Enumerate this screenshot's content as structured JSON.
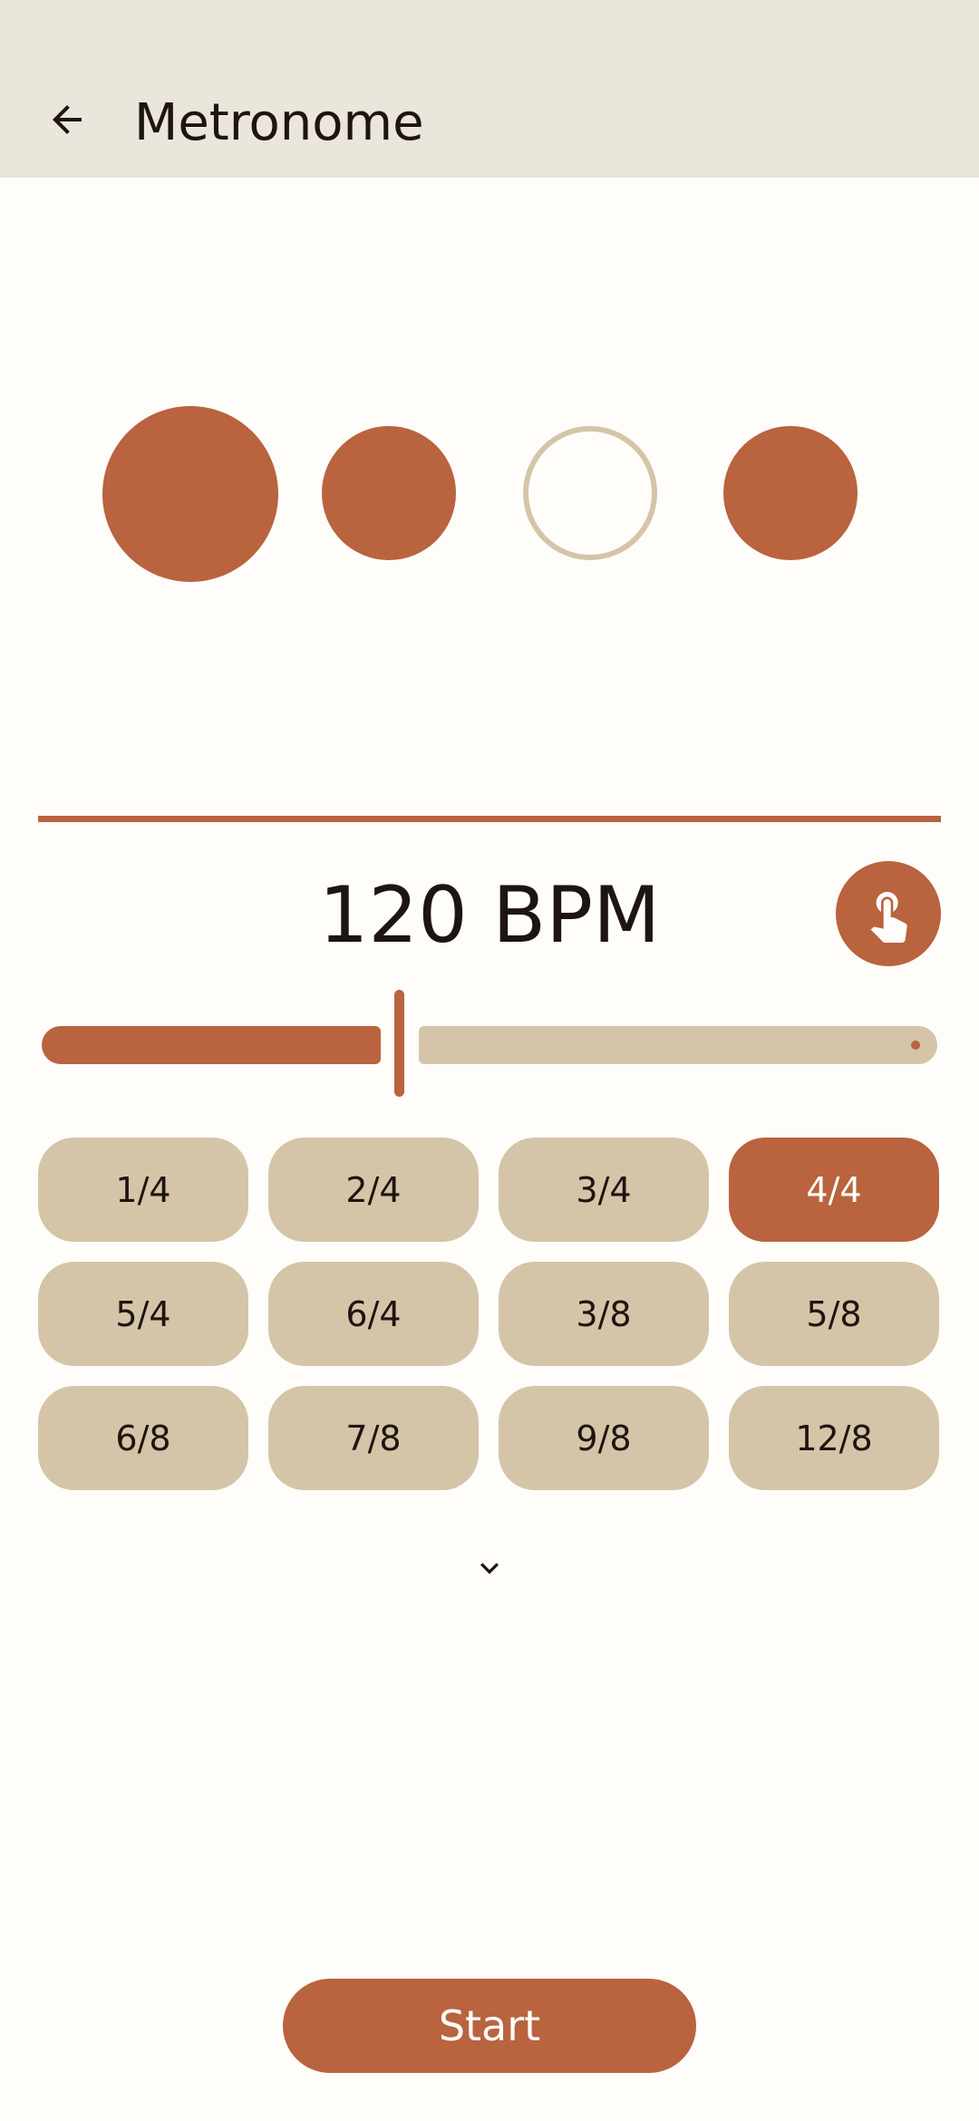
{
  "app_bar": {
    "title": "Metronome",
    "back_icon": "arrow-left-icon"
  },
  "beats": [
    {
      "state": "accent",
      "color": "#b9633f"
    },
    {
      "state": "normal",
      "color": "#b9633f"
    },
    {
      "state": "muted",
      "color": "#d4c5a8"
    },
    {
      "state": "normal",
      "color": "#b9633f"
    }
  ],
  "tempo": {
    "bpm_label": "120 BPM",
    "bpm": 120,
    "slider_fraction": 0.38,
    "tap_icon": "tap-hand-icon"
  },
  "time_signatures": {
    "options": [
      "1/4",
      "2/4",
      "3/4",
      "4/4",
      "5/4",
      "6/4",
      "3/8",
      "5/8",
      "6/8",
      "7/8",
      "9/8",
      "12/8"
    ],
    "selected": "4/4",
    "expand_icon": "chevron-down-icon"
  },
  "start_button": {
    "label": "Start"
  },
  "colors": {
    "accent": "#b9633f",
    "surface": "#fefdf9",
    "app_bar": "#eae6dc",
    "chip": "#d4c5a8",
    "text": "#1e1410"
  }
}
